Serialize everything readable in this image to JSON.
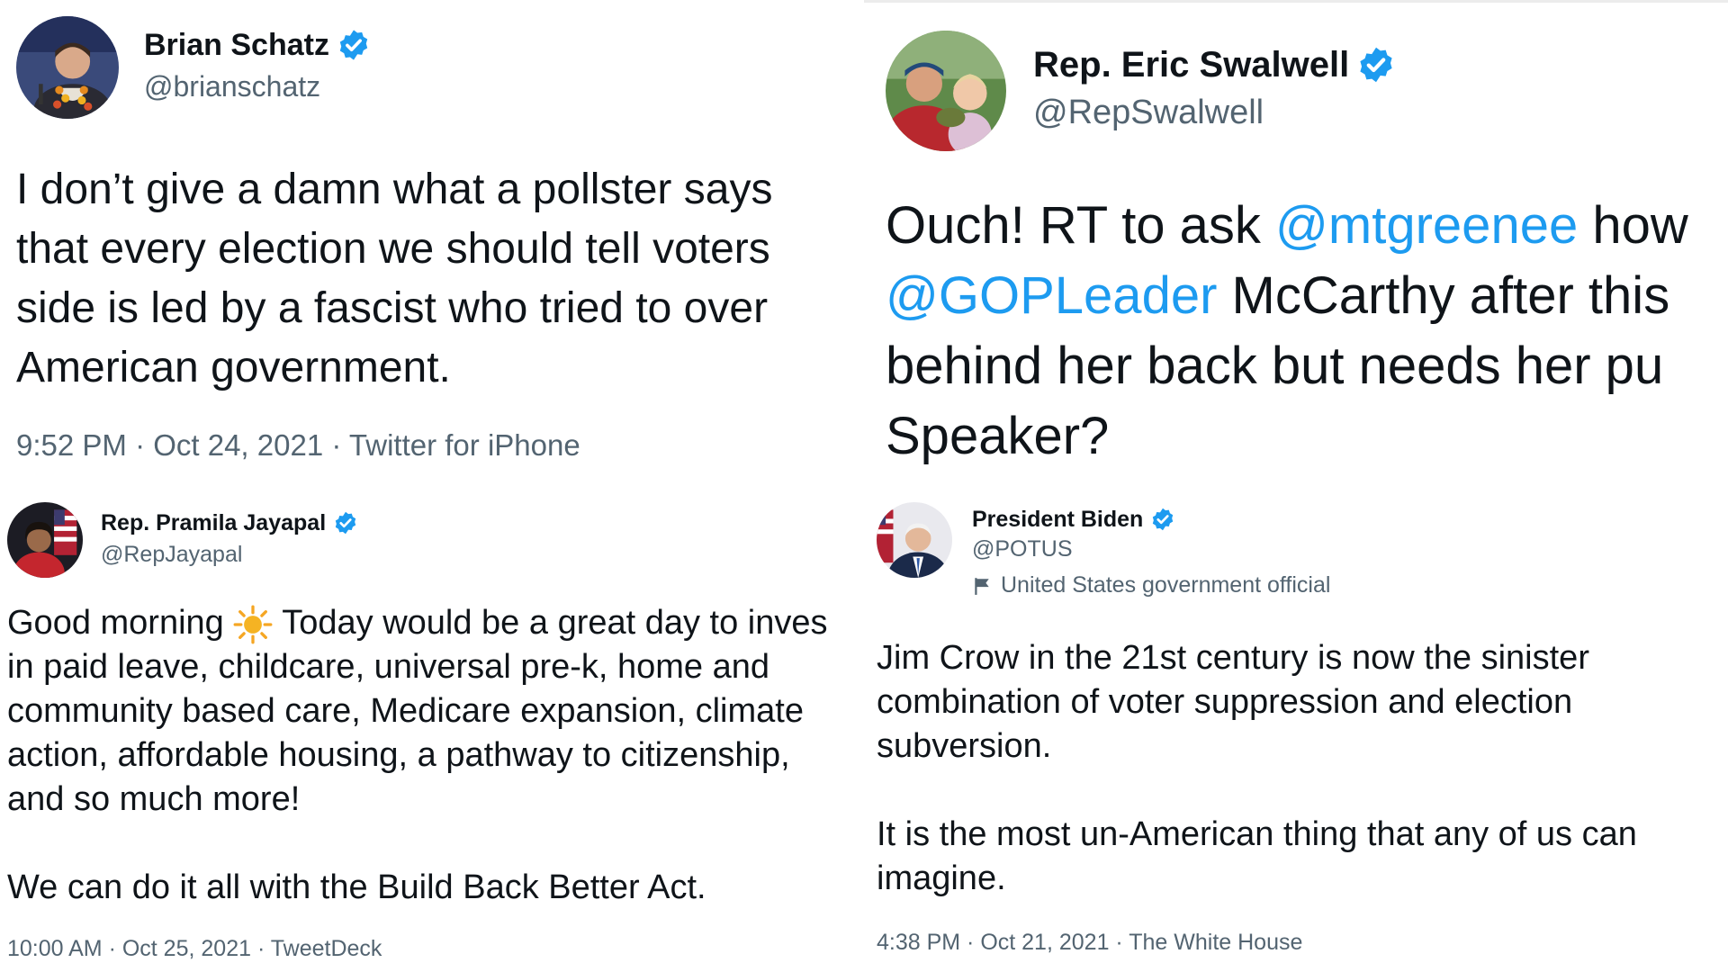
{
  "colors": {
    "mention": "#1d9bf0",
    "secondary_text": "#536471",
    "verified_badge": "#1d9bf0"
  },
  "tweets": {
    "schatz": {
      "name": "Brian Schatz",
      "handle": "@brianschatz",
      "lines": [
        "I don’t give a damn what a pollster says",
        "that every election we should tell voters",
        "side is led by a fascist who tried to over",
        "American government."
      ],
      "meta": "9:52 PM · Oct 24, 2021 · Twitter for iPhone",
      "avatar_icon": "avatar-photo",
      "badge_icon": "verified-badge-icon"
    },
    "swalwell": {
      "name": "Rep. Eric Swalwell",
      "handle": "@RepSwalwell",
      "line1_pre": "Ouch! RT to ask ",
      "line1_mention": "@mtgreenee",
      "line1_post": " how",
      "line2_mention": "@GOPLeader",
      "line2_post": " McCarthy after this",
      "line3": "behind her back but needs her pu",
      "line4": "Speaker?",
      "avatar_icon": "avatar-photo",
      "badge_icon": "verified-badge-icon"
    },
    "jayapal": {
      "name": "Rep. Pramila Jayapal",
      "handle": "@RepJayapal",
      "line1_pre": "Good morning ",
      "line1_post": " Today would be a great day to inves",
      "sun_icon": "sun-emoji-icon",
      "lines": [
        "in paid leave, childcare, universal pre-k, home and",
        "community based care, Medicare expansion, climate",
        "action, affordable housing, a pathway to citizenship,",
        "and so much more!"
      ],
      "line_last": "We can do it all with the Build Back Better Act.",
      "meta": "10:00 AM · Oct 25, 2021 · TweetDeck",
      "avatar_icon": "avatar-photo",
      "badge_icon": "verified-badge-icon"
    },
    "biden": {
      "name": "President Biden",
      "handle": "@POTUS",
      "label": "United States government official",
      "label_icon": "flag-icon",
      "lines": [
        "Jim Crow in the 21st century is now the sinister",
        "combination of voter suppression and election",
        "subversion."
      ],
      "lines2": [
        "It is the most un-American thing that any of us can",
        "imagine."
      ],
      "meta": "4:38 PM · Oct 21, 2021 · The White House",
      "avatar_icon": "avatar-photo",
      "badge_icon": "verified-badge-icon"
    }
  }
}
